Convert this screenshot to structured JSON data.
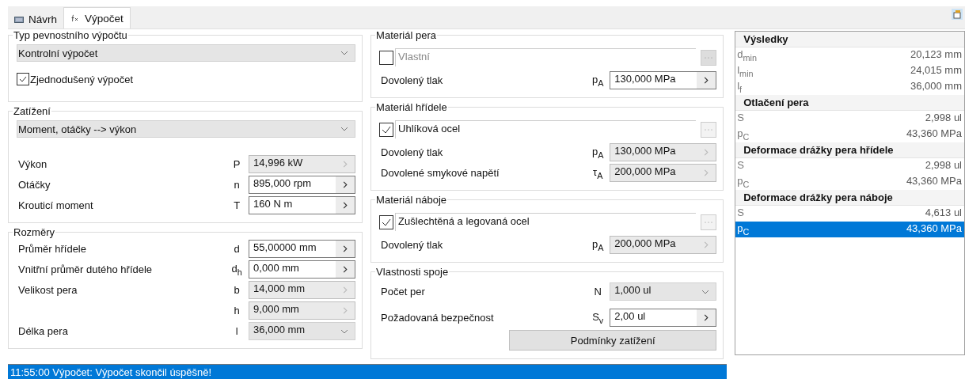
{
  "tabs": [
    {
      "label": "Návrh",
      "selected": false
    },
    {
      "label": "Výpočet",
      "selected": true
    }
  ],
  "left": [
    {
      "title": "Typ pevnostního výpočtu",
      "dropdown": "Kontrolní výpočet",
      "checkbox": {
        "label": "Zjednodušený výpočet",
        "checked": true
      }
    },
    {
      "title": "Zatížení",
      "dropdown": "Moment, otáčky --> výkon",
      "fields": [
        {
          "label": "Výkon",
          "symbol": "P",
          "value": "14,996 kW",
          "kind": "arrow",
          "disabled": true
        },
        {
          "label": "Otáčky",
          "symbol": "n",
          "value": "895,000 rpm",
          "kind": "arrow",
          "disabled": false
        },
        {
          "label": "Krouticí moment",
          "symbol": "T",
          "value": "160 N m",
          "kind": "arrow",
          "disabled": false
        }
      ]
    },
    {
      "title": "Rozměry",
      "fields": [
        {
          "label": "Průměr hřídele",
          "symbol": "d",
          "value": "55,00000 mm",
          "kind": "arrow",
          "disabled": false
        },
        {
          "label": "Vnitřní průměr dutého hřídele",
          "symbol": "d$_{h}$",
          "value": "0,000 mm",
          "kind": "arrow",
          "disabled": false
        },
        {
          "label": "Velikost pera",
          "symbol": "b",
          "value": "14,000 mm",
          "kind": "arrow",
          "disabled": true
        },
        {
          "symbol": "h",
          "value": "9,000 mm",
          "kind": "arrow",
          "disabled": true
        },
        {
          "label": "Délka pera",
          "symbol": "l",
          "value": "36,000 mm",
          "kind": "dropdown",
          "disabled": true
        }
      ]
    }
  ],
  "middle": [
    {
      "title": "Materiál pera",
      "material": {
        "name": "Vlastní",
        "checked": false
      },
      "fields": [
        {
          "label": "Dovolený tlak",
          "symbol": "p$_{A}$",
          "value": "130,000 MPa",
          "kind": "arrow",
          "disabled": false
        }
      ]
    },
    {
      "title": "Materiál hřídele",
      "material": {
        "name": "Uhlíková ocel",
        "checked": true
      },
      "fields": [
        {
          "label": "Dovolený tlak",
          "symbol": "p$_{A}$",
          "value": "130,000 MPa",
          "kind": "arrow",
          "disabled": true
        },
        {
          "label": "Dovolené smykové napětí",
          "symbol": "τ$_{A}$",
          "value": "200,000 MPa",
          "kind": "arrow",
          "disabled": true
        }
      ]
    },
    {
      "title": "Materiál náboje",
      "material": {
        "name": "Zušlechtěná a legovaná ocel",
        "checked": true
      },
      "fields": [
        {
          "label": "Dovolený tlak",
          "symbol": "p$_{A}$",
          "value": "200,000 MPa",
          "kind": "arrow",
          "disabled": true
        }
      ]
    },
    {
      "title": "Vlastnosti spoje",
      "fields": [
        {
          "label": "Počet per",
          "symbol": "N",
          "value": "1,000 ul",
          "kind": "dropdown",
          "disabled": true
        },
        {
          "label": "Požadovaná bezpečnost",
          "symbol": "S$_{v}$",
          "value": "2,00 ul",
          "kind": "arrow",
          "disabled": false
        }
      ],
      "button": "Podmínky zatížení"
    }
  ],
  "results": [
    {
      "title": "Výsledky",
      "rows": [
        {
          "symbol": "d$_{min}$",
          "value": "20,123 mm",
          "selected": false
        },
        {
          "symbol": "l$_{min}$",
          "value": "24,015 mm",
          "selected": false
        },
        {
          "symbol": "l$_{f}$",
          "value": "36,000 mm",
          "selected": false
        }
      ]
    },
    {
      "title": "Otlačení pera",
      "rows": [
        {
          "symbol": "S",
          "value": "2,998 ul",
          "selected": false
        },
        {
          "symbol": "p$_{C}$",
          "value": "43,360 MPa",
          "selected": false
        }
      ]
    },
    {
      "title": "Deformace drážky pera hřídele",
      "rows": [
        {
          "symbol": "S",
          "value": "2,998 ul",
          "selected": false
        },
        {
          "symbol": "p$_{C}$",
          "value": "43,360 MPa",
          "selected": false
        }
      ]
    },
    {
      "title": "Deformace drážky pera náboje",
      "rows": [
        {
          "symbol": "S",
          "value": "4,613 ul",
          "selected": false
        },
        {
          "symbol": "p$_{C}$",
          "value": "43,360 MPa",
          "selected": true
        }
      ]
    }
  ],
  "status_bar": "11:55:00 Výpočet: Výpočet skončil úspěšně!"
}
